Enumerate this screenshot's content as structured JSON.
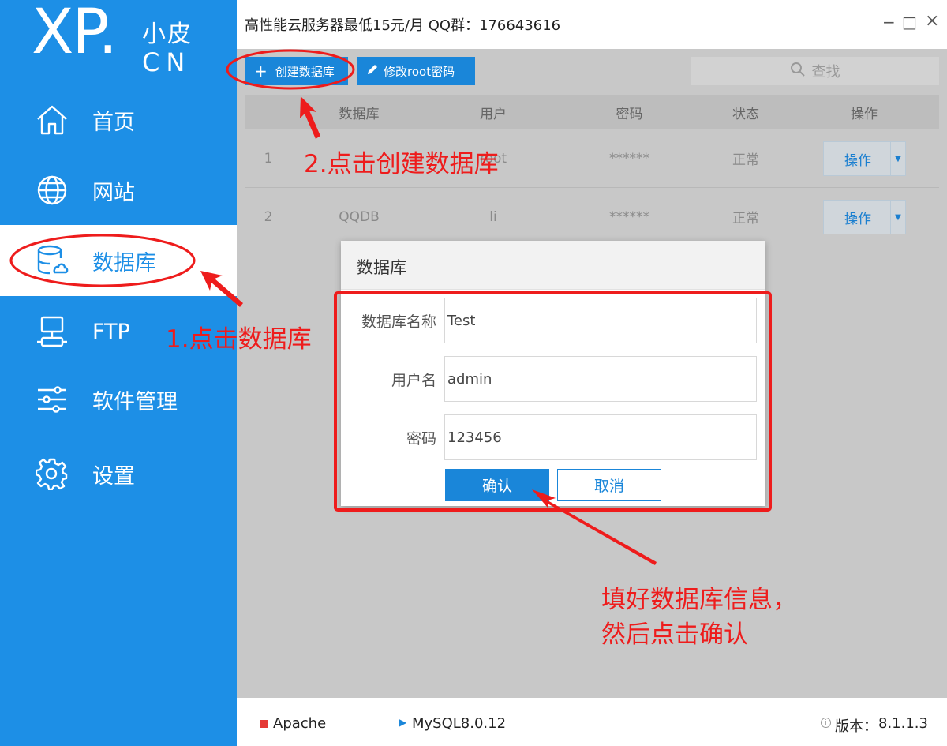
{
  "logo": {
    "mark": "XP.",
    "text_top": "小皮",
    "text_bottom": "CN"
  },
  "sidebar": {
    "items": [
      {
        "label": "首页",
        "icon": "home-icon"
      },
      {
        "label": "网站",
        "icon": "globe-icon"
      },
      {
        "label": "数据库",
        "icon": "database-icon",
        "active": true
      },
      {
        "label": "FTP",
        "icon": "ftp-icon"
      },
      {
        "label": "软件管理",
        "icon": "sliders-icon"
      },
      {
        "label": "设置",
        "icon": "gear-icon"
      }
    ]
  },
  "titlebar": {
    "title": "高性能云服务器最低15元/月  QQ群：176643616",
    "minimize": "−",
    "maximize": "□",
    "close": "×"
  },
  "toolbar": {
    "create_label": "创建数据库",
    "modify_label": "修改root密码",
    "search_placeholder": "查找"
  },
  "table": {
    "headers": [
      "数据库",
      "用户",
      "密码",
      "状态",
      "操作"
    ],
    "rows": [
      {
        "index": "1",
        "database": "",
        "user": "root",
        "password": "******",
        "status": "正常",
        "action": "操作"
      },
      {
        "index": "2",
        "database": "QQDB",
        "user": "li",
        "password": "******",
        "status": "正常",
        "action": "操作"
      }
    ]
  },
  "dialog": {
    "title": "数据库",
    "fields": [
      {
        "label": "数据库名称",
        "value": "Test"
      },
      {
        "label": "用户名",
        "value": "admin"
      },
      {
        "label": "密码",
        "value": "123456"
      }
    ],
    "ok_label": "确认",
    "cancel_label": "取消"
  },
  "statusbar": {
    "apache": "Apache",
    "mysql": "MySQL8.0.12",
    "version_label": "版本：",
    "version": "8.1.1.3"
  },
  "annotations": {
    "step1": "1.点击数据库",
    "step2": "2.点击创建数据库",
    "step3_line1": "填好数据库信息，",
    "step3_line2": "然后点击确认"
  },
  "colors": {
    "brand_blue": "#1d8fe6",
    "annotation_red": "#ee1c1c",
    "apache_red": "#e53935"
  }
}
